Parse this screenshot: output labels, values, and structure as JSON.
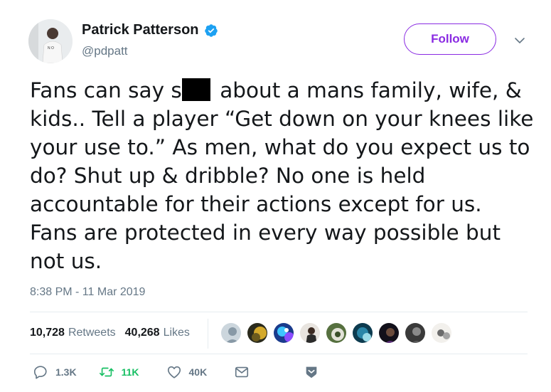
{
  "user": {
    "display_name": "Patrick Patterson",
    "handle": "@pdpatt",
    "verified": true
  },
  "follow_label": "Follow",
  "tweet": {
    "text_before": "Fans can say s",
    "text_after": " about a mans family, wife, & kids.. Tell a player “Get down on your knees like your use to.” As men, what do you expect us to do? Shut up & dribble? No one is held accountable for their actions except for us. Fans are protected in every way possible but not us.",
    "timestamp": "8:38 PM - 11 Mar 2019"
  },
  "stats": {
    "retweets_count": "10,728",
    "retweets_label": "Retweets",
    "likes_count": "40,268",
    "likes_label": "Likes"
  },
  "actions": {
    "reply_count": "1.3K",
    "retweet_count": "11K",
    "like_count": "40K"
  },
  "colors": {
    "accent": "#8a2be2",
    "verified": "#1da1f2",
    "retweet": "#17bf63",
    "muted": "#657786"
  }
}
